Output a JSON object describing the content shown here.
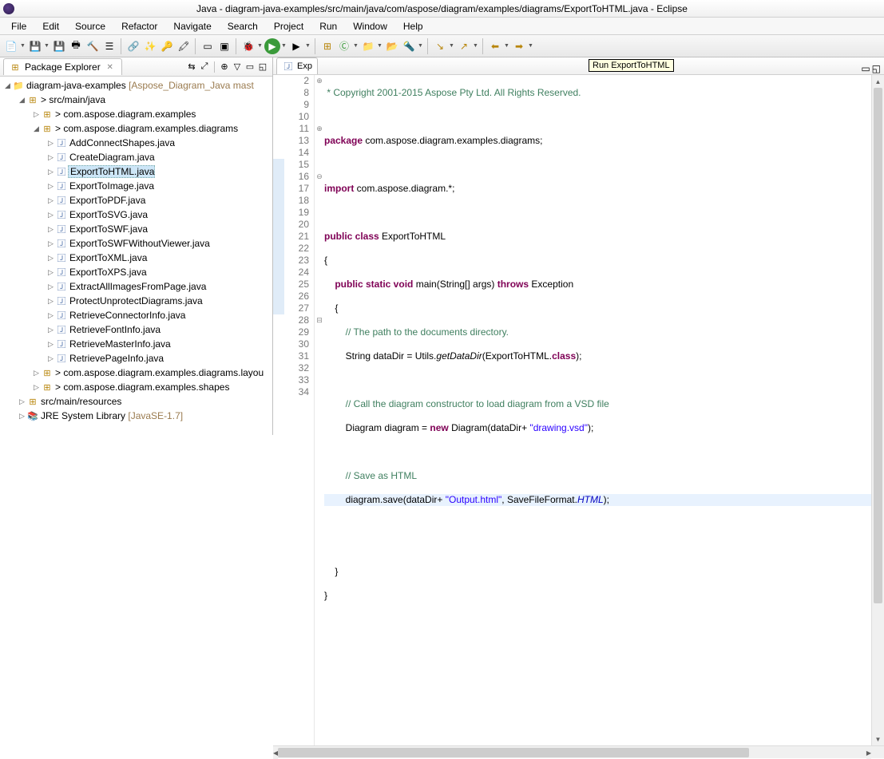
{
  "window": {
    "title": "Java - diagram-java-examples/src/main/java/com/aspose/diagram/examples/diagrams/ExportToHTML.java - Eclipse"
  },
  "menu": [
    "File",
    "Edit",
    "Source",
    "Refactor",
    "Navigate",
    "Search",
    "Project",
    "Run",
    "Window",
    "Help"
  ],
  "explorer": {
    "title": "Package Explorer",
    "project": "diagram-java-examples",
    "project_deco": "[Aspose_Diagram_Java mast",
    "srcfolder": "src/main/java",
    "pkg1": "com.aspose.diagram.examples",
    "pkg2": "com.aspose.diagram.examples.diagrams",
    "files": [
      "AddConnectShapes.java",
      "CreateDiagram.java",
      "ExportToHTML.java",
      "ExportToImage.java",
      "ExportToPDF.java",
      "ExportToSVG.java",
      "ExportToSWF.java",
      "ExportToSWFWithoutViewer.java",
      "ExportToXML.java",
      "ExportToXPS.java",
      "ExtractAllImagesFromPage.java",
      "ProtectUnprotectDiagrams.java",
      "RetrieveConnectorInfo.java",
      "RetrieveFontInfo.java",
      "RetrieveMasterInfo.java",
      "RetrievePageInfo.java"
    ],
    "pkg3": "com.aspose.diagram.examples.diagrams.layou",
    "pkg4": "com.aspose.diagram.examples.shapes",
    "resources": "src/main/resources",
    "jre": "JRE System Library",
    "jre_deco": "[JavaSE-1.7]"
  },
  "editor": {
    "tab_short": "Exp",
    "tooltip": "Run ExportToHTML",
    "lines": {
      "l2": " * Copyright 2001-2015 Aspose Pty Ltd. All Rights Reserved.",
      "l9a": "package",
      "l9b": " com.aspose.diagram.examples.diagrams;",
      "l11a": "import",
      "l11b": " com.aspose.diagram.*;",
      "l14a": "public class",
      "l14b": " ExportToHTML",
      "l15": "{",
      "l16a": "    public static void",
      "l16b": " main(String[] args) ",
      "l16c": "throws",
      "l16d": " Exception",
      "l17": "    {",
      "l18": "        // The path to the documents directory.",
      "l19a": "        String dataDir = Utils.",
      "l19b": "getDataDir",
      "l19c": "(ExportToHTML.",
      "l19d": "class",
      "l19e": ");",
      "l21": "        // Call the diagram constructor to load diagram from a VSD file",
      "l22a": "        Diagram diagram = ",
      "l22b": "new",
      "l22c": " Diagram(dataDir+ ",
      "l22d": "\"drawing.vsd\"",
      "l22e": ");",
      "l24": "        // Save as HTML",
      "l25a": "        diagram.save(dataDir+ ",
      "l25b": "\"Output.html\"",
      "l25c": ", SaveFileFormat.",
      "l25d": "HTML",
      "l25e": ");",
      "l28": "    }",
      "l29": "}"
    },
    "linenumbers": [
      "2",
      "8",
      "9",
      "10",
      "11",
      "13",
      "14",
      "15",
      "16",
      "17",
      "18",
      "19",
      "20",
      "21",
      "22",
      "23",
      "24",
      "25",
      "26",
      "27",
      "28",
      "29",
      "30",
      "31",
      "32",
      "33",
      "34"
    ]
  }
}
